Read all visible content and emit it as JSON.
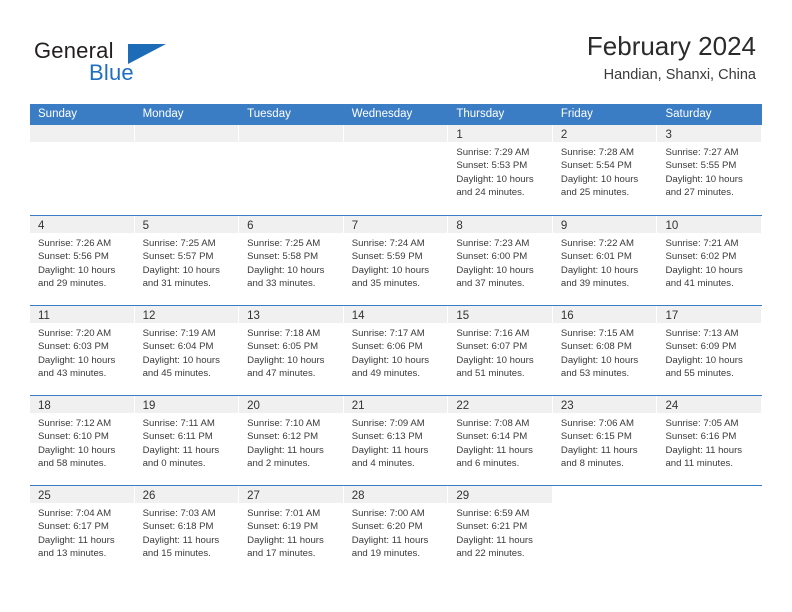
{
  "brand": {
    "name_top": "General",
    "name_bottom": "Blue",
    "triangle_icon": "blue-triangle-icon",
    "colors": {
      "dark": "#231f20",
      "blue": "#1d6cb8"
    }
  },
  "header": {
    "title": "February 2024",
    "subtitle": "Handian, Shanxi, China"
  },
  "colors": {
    "header_blue": "#3b7dc4",
    "daynum_band": "#f0f0f0",
    "text": "#3a3a3a"
  },
  "weekdays": [
    "Sunday",
    "Monday",
    "Tuesday",
    "Wednesday",
    "Thursday",
    "Friday",
    "Saturday"
  ],
  "weeks": [
    [
      {
        "day": "",
        "empty": true
      },
      {
        "day": "",
        "empty": true
      },
      {
        "day": "",
        "empty": true
      },
      {
        "day": "",
        "empty": true
      },
      {
        "day": "1",
        "sunrise": "Sunrise: 7:29 AM",
        "sunset": "Sunset: 5:53 PM",
        "daylight_line1": "Daylight: 10 hours",
        "daylight_line2": "and 24 minutes."
      },
      {
        "day": "2",
        "sunrise": "Sunrise: 7:28 AM",
        "sunset": "Sunset: 5:54 PM",
        "daylight_line1": "Daylight: 10 hours",
        "daylight_line2": "and 25 minutes."
      },
      {
        "day": "3",
        "sunrise": "Sunrise: 7:27 AM",
        "sunset": "Sunset: 5:55 PM",
        "daylight_line1": "Daylight: 10 hours",
        "daylight_line2": "and 27 minutes."
      }
    ],
    [
      {
        "day": "4",
        "sunrise": "Sunrise: 7:26 AM",
        "sunset": "Sunset: 5:56 PM",
        "daylight_line1": "Daylight: 10 hours",
        "daylight_line2": "and 29 minutes."
      },
      {
        "day": "5",
        "sunrise": "Sunrise: 7:25 AM",
        "sunset": "Sunset: 5:57 PM",
        "daylight_line1": "Daylight: 10 hours",
        "daylight_line2": "and 31 minutes."
      },
      {
        "day": "6",
        "sunrise": "Sunrise: 7:25 AM",
        "sunset": "Sunset: 5:58 PM",
        "daylight_line1": "Daylight: 10 hours",
        "daylight_line2": "and 33 minutes."
      },
      {
        "day": "7",
        "sunrise": "Sunrise: 7:24 AM",
        "sunset": "Sunset: 5:59 PM",
        "daylight_line1": "Daylight: 10 hours",
        "daylight_line2": "and 35 minutes."
      },
      {
        "day": "8",
        "sunrise": "Sunrise: 7:23 AM",
        "sunset": "Sunset: 6:00 PM",
        "daylight_line1": "Daylight: 10 hours",
        "daylight_line2": "and 37 minutes."
      },
      {
        "day": "9",
        "sunrise": "Sunrise: 7:22 AM",
        "sunset": "Sunset: 6:01 PM",
        "daylight_line1": "Daylight: 10 hours",
        "daylight_line2": "and 39 minutes."
      },
      {
        "day": "10",
        "sunrise": "Sunrise: 7:21 AM",
        "sunset": "Sunset: 6:02 PM",
        "daylight_line1": "Daylight: 10 hours",
        "daylight_line2": "and 41 minutes."
      }
    ],
    [
      {
        "day": "11",
        "sunrise": "Sunrise: 7:20 AM",
        "sunset": "Sunset: 6:03 PM",
        "daylight_line1": "Daylight: 10 hours",
        "daylight_line2": "and 43 minutes."
      },
      {
        "day": "12",
        "sunrise": "Sunrise: 7:19 AM",
        "sunset": "Sunset: 6:04 PM",
        "daylight_line1": "Daylight: 10 hours",
        "daylight_line2": "and 45 minutes."
      },
      {
        "day": "13",
        "sunrise": "Sunrise: 7:18 AM",
        "sunset": "Sunset: 6:05 PM",
        "daylight_line1": "Daylight: 10 hours",
        "daylight_line2": "and 47 minutes."
      },
      {
        "day": "14",
        "sunrise": "Sunrise: 7:17 AM",
        "sunset": "Sunset: 6:06 PM",
        "daylight_line1": "Daylight: 10 hours",
        "daylight_line2": "and 49 minutes."
      },
      {
        "day": "15",
        "sunrise": "Sunrise: 7:16 AM",
        "sunset": "Sunset: 6:07 PM",
        "daylight_line1": "Daylight: 10 hours",
        "daylight_line2": "and 51 minutes."
      },
      {
        "day": "16",
        "sunrise": "Sunrise: 7:15 AM",
        "sunset": "Sunset: 6:08 PM",
        "daylight_line1": "Daylight: 10 hours",
        "daylight_line2": "and 53 minutes."
      },
      {
        "day": "17",
        "sunrise": "Sunrise: 7:13 AM",
        "sunset": "Sunset: 6:09 PM",
        "daylight_line1": "Daylight: 10 hours",
        "daylight_line2": "and 55 minutes."
      }
    ],
    [
      {
        "day": "18",
        "sunrise": "Sunrise: 7:12 AM",
        "sunset": "Sunset: 6:10 PM",
        "daylight_line1": "Daylight: 10 hours",
        "daylight_line2": "and 58 minutes."
      },
      {
        "day": "19",
        "sunrise": "Sunrise: 7:11 AM",
        "sunset": "Sunset: 6:11 PM",
        "daylight_line1": "Daylight: 11 hours",
        "daylight_line2": "and 0 minutes."
      },
      {
        "day": "20",
        "sunrise": "Sunrise: 7:10 AM",
        "sunset": "Sunset: 6:12 PM",
        "daylight_line1": "Daylight: 11 hours",
        "daylight_line2": "and 2 minutes."
      },
      {
        "day": "21",
        "sunrise": "Sunrise: 7:09 AM",
        "sunset": "Sunset: 6:13 PM",
        "daylight_line1": "Daylight: 11 hours",
        "daylight_line2": "and 4 minutes."
      },
      {
        "day": "22",
        "sunrise": "Sunrise: 7:08 AM",
        "sunset": "Sunset: 6:14 PM",
        "daylight_line1": "Daylight: 11 hours",
        "daylight_line2": "and 6 minutes."
      },
      {
        "day": "23",
        "sunrise": "Sunrise: 7:06 AM",
        "sunset": "Sunset: 6:15 PM",
        "daylight_line1": "Daylight: 11 hours",
        "daylight_line2": "and 8 minutes."
      },
      {
        "day": "24",
        "sunrise": "Sunrise: 7:05 AM",
        "sunset": "Sunset: 6:16 PM",
        "daylight_line1": "Daylight: 11 hours",
        "daylight_line2": "and 11 minutes."
      }
    ],
    [
      {
        "day": "25",
        "sunrise": "Sunrise: 7:04 AM",
        "sunset": "Sunset: 6:17 PM",
        "daylight_line1": "Daylight: 11 hours",
        "daylight_line2": "and 13 minutes."
      },
      {
        "day": "26",
        "sunrise": "Sunrise: 7:03 AM",
        "sunset": "Sunset: 6:18 PM",
        "daylight_line1": "Daylight: 11 hours",
        "daylight_line2": "and 15 minutes."
      },
      {
        "day": "27",
        "sunrise": "Sunrise: 7:01 AM",
        "sunset": "Sunset: 6:19 PM",
        "daylight_line1": "Daylight: 11 hours",
        "daylight_line2": "and 17 minutes."
      },
      {
        "day": "28",
        "sunrise": "Sunrise: 7:00 AM",
        "sunset": "Sunset: 6:20 PM",
        "daylight_line1": "Daylight: 11 hours",
        "daylight_line2": "and 19 minutes."
      },
      {
        "day": "29",
        "sunrise": "Sunrise: 6:59 AM",
        "sunset": "Sunset: 6:21 PM",
        "daylight_line1": "Daylight: 11 hours",
        "daylight_line2": "and 22 minutes."
      },
      {
        "day": "",
        "empty": true,
        "no_band": true
      },
      {
        "day": "",
        "empty": true,
        "no_band": true
      }
    ]
  ]
}
